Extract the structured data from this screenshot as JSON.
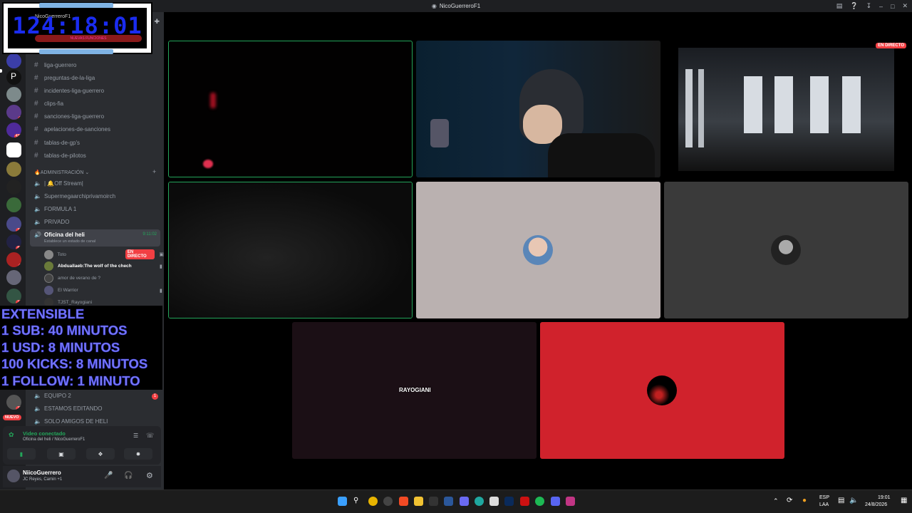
{
  "window": {
    "title": "NicoGuerreroF1",
    "controls": [
      "inbox-icon",
      "help-icon",
      "download-icon",
      "minimize-icon",
      "maximize-icon",
      "close-icon"
    ]
  },
  "overlay_timer": {
    "time": "124:18:01",
    "line1": "NicoGuerreroF1",
    "line2": "NUEVAS FUNCIONES"
  },
  "server_badges": [
    "8",
    "437",
    "74",
    "64",
    "8",
    "16",
    "12"
  ],
  "new_label": "NUEVO",
  "channels": {
    "text": [
      "liga-guerrero",
      "preguntas-de-la-liga",
      "incidentes-liga-guerrero",
      "clips-fia",
      "sanciones-liga-guerrero",
      "apelaciones-de-sanciones",
      "tablas-de-gp's",
      "tablas-de-pilotos"
    ],
    "category": "🔥ADMINISTRACIÓN",
    "voice": [
      "| 🔔Off Stream|",
      "Supermegaarchiprivamoirch",
      "FORMULA 1",
      "PRIVADO"
    ],
    "active": {
      "name": "Oficina del heli",
      "elapsed": "9:11:02",
      "status": "Establece un estado de canal"
    },
    "members": [
      {
        "name": "Toto",
        "live": "EN DIRECTO"
      },
      {
        "name": "Abduallaeb:The wolf of the chech"
      },
      {
        "name": "amor de verano de ?"
      },
      {
        "name": "El Warrior"
      },
      {
        "name": "TJST_Rayogiani"
      }
    ],
    "lower_voice": [
      "EQUIPO 2",
      "ESTAMOS EDITANDO",
      "SOLO AMIGOS DE HELI"
    ],
    "lower_badge": "1"
  },
  "promo": [
    "EXTENSIBLE",
    "1 SUB: 40 MINUTOS",
    "1 USD: 8 MINUTOS",
    "100 KICKS: 8 MINUTOS",
    "1 FOLLOW: 1 MINUTO"
  ],
  "voice_panel": {
    "status": "Video conectado",
    "location": "Oficina del heli / NicoGuerreroF1"
  },
  "user_panel": {
    "name": "NiicoGuerrero",
    "status": "JC Reyes, Camin +1"
  },
  "stage": {
    "live_badge": "EN DIRECTO",
    "rayogiani_label": "RAYOGIANI"
  },
  "colors": {
    "accent_green": "#23a55a",
    "live_red": "#f23f43",
    "tile_grey": "#bab1b0",
    "tile_dark": "#3a3a3a",
    "tile_red": "#d0222c",
    "promo_text": "#7a7bf3",
    "timer_blue": "#1a2cf0"
  },
  "taskbar": {
    "lang1": "ESP",
    "lang2": "LAA",
    "time": "19:01",
    "date": "24/8/2026"
  }
}
